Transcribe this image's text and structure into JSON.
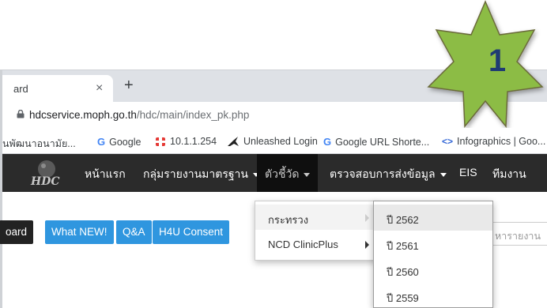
{
  "tab": {
    "title": "ard",
    "close": "×",
    "new_tab": "+"
  },
  "address": {
    "domain": "hdcservice.moph.go.th",
    "path": "/hdc/main/index_pk.php"
  },
  "bookmarks": [
    {
      "label": "นพัฒนาอนามัย...",
      "icon": "thai-site-icon"
    },
    {
      "label": "Google",
      "icon": "google-icon"
    },
    {
      "label": "10.1.1.254",
      "icon": "red-network-icon"
    },
    {
      "label": "Unleashed Login",
      "icon": "unleashed-icon"
    },
    {
      "label": "Google URL Shorte...",
      "icon": "google-icon"
    },
    {
      "label": "Infographics | Goo...",
      "icon": "code-icon"
    }
  ],
  "nav": {
    "items": [
      {
        "label": "หน้าแรก"
      },
      {
        "label": "กลุ่มรายงานมาตรฐาน"
      },
      {
        "label": "ตัวชี้วัด"
      },
      {
        "label": "ตรวจสอบการส่งข้อมูล"
      },
      {
        "label": "EIS"
      },
      {
        "label": "ทีมงาน"
      }
    ]
  },
  "buttons": [
    {
      "label": "oard"
    },
    {
      "label": "What NEW!"
    },
    {
      "label": "Q&A"
    },
    {
      "label": "H4U Consent"
    }
  ],
  "search": {
    "placeholder": "หารายงาน"
  },
  "menu_indicator": {
    "items": [
      {
        "label": "กระทรวง"
      },
      {
        "label": "NCD ClinicPlus"
      }
    ]
  },
  "menu_years": {
    "items": [
      {
        "label": "ปี 2562"
      },
      {
        "label": "ปี 2561"
      },
      {
        "label": "ปี 2560"
      },
      {
        "label": "ปี 2559"
      }
    ]
  },
  "badge": {
    "number": "1"
  },
  "colors": {
    "navbar": "#2b2b2b",
    "button_blue": "#2f96df",
    "star_green": "#8cbc45",
    "badge_text": "#1f3b73"
  }
}
